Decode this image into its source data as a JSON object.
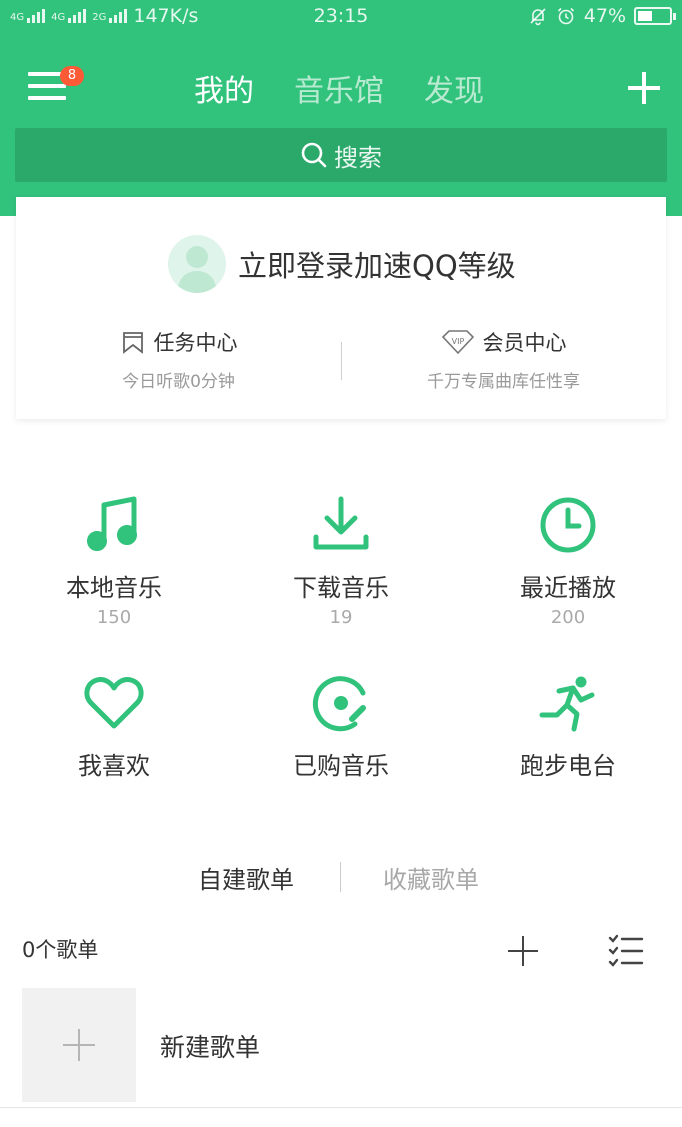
{
  "status_bar": {
    "network_1": "4G",
    "network_2": "4G",
    "network_3": "2G",
    "speed": "147K/s",
    "time": "23:15",
    "battery": "47%",
    "battery_level": 0.47
  },
  "nav": {
    "badge_count": "8",
    "tabs": [
      "我的",
      "音乐馆",
      "发现"
    ],
    "active_tab": 0
  },
  "search": {
    "placeholder": "搜索"
  },
  "account": {
    "login_prompt": "立即登录加速QQ等级",
    "task_center": {
      "title": "任务中心",
      "subtitle": "今日听歌0分钟"
    },
    "vip_center": {
      "title": "会员中心",
      "subtitle": "千万专属曲库任性享",
      "badge": "VIP"
    }
  },
  "grid": [
    {
      "label": "本地音乐",
      "count": "150",
      "icon": "music-note-icon"
    },
    {
      "label": "下载音乐",
      "count": "19",
      "icon": "download-icon"
    },
    {
      "label": "最近播放",
      "count": "200",
      "icon": "clock-icon"
    },
    {
      "label": "我喜欢",
      "icon": "heart-icon"
    },
    {
      "label": "已购音乐",
      "icon": "purchased-disc-icon"
    },
    {
      "label": "跑步电台",
      "icon": "running-icon"
    }
  ],
  "playlists": {
    "tabs": [
      "自建歌单",
      "收藏歌单"
    ],
    "count_label": "0个歌单",
    "new_playlist_label": "新建歌单"
  },
  "colors": {
    "brand_green": "#31c27c",
    "search_bg": "#2aa96b",
    "badge_red": "#ff5a36"
  }
}
